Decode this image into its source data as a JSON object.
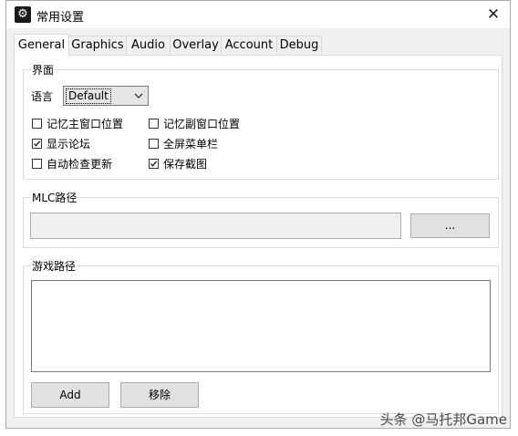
{
  "window": {
    "title": "常用设置",
    "app_icon_glyph": "⚙",
    "close_glyph": "✕"
  },
  "tabs": [
    {
      "label": "General",
      "active": true
    },
    {
      "label": "Graphics",
      "active": false
    },
    {
      "label": "Audio",
      "active": false
    },
    {
      "label": "Overlay",
      "active": false
    },
    {
      "label": "Account",
      "active": false
    },
    {
      "label": "Debug",
      "active": false
    }
  ],
  "interface_group": {
    "label": "界面",
    "language_label": "语言",
    "language_value": "Default",
    "checkboxes": [
      {
        "label": "记忆主窗口位置",
        "checked": false
      },
      {
        "label": "记忆副窗口位置",
        "checked": false
      },
      {
        "label": "显示论坛",
        "checked": true
      },
      {
        "label": "全屏菜单栏",
        "checked": false
      },
      {
        "label": "自动检查更新",
        "checked": false
      },
      {
        "label": "保存截图",
        "checked": true
      }
    ]
  },
  "mlc_group": {
    "label": "MLC路径",
    "path_value": "",
    "browse_label": "..."
  },
  "game_paths_group": {
    "label": "游戏路径",
    "add_label": "Add",
    "remove_label": "移除"
  },
  "watermark": "头条 @马托邦Game",
  "colors": {
    "dialog_bg": "#f0f0f0",
    "panel_bg": "#ffffff",
    "button_bg": "#e1e1e1",
    "border": "#adadad"
  }
}
